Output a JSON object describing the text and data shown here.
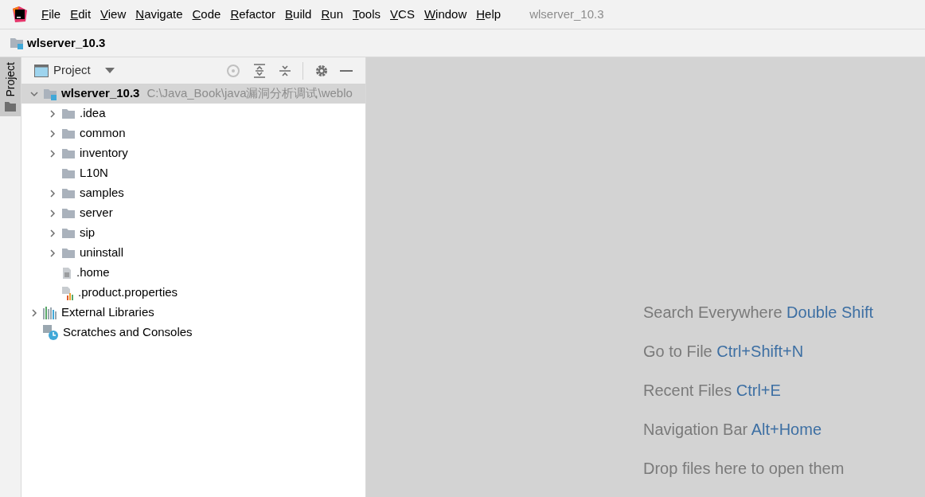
{
  "menu": [
    "File",
    "Edit",
    "View",
    "Navigate",
    "Code",
    "Refactor",
    "Build",
    "Run",
    "Tools",
    "VCS",
    "Window",
    "Help"
  ],
  "window_title": "wlserver_10.3",
  "breadcrumb": "wlserver_10.3",
  "side_tab": {
    "label": "Project",
    "selected": true
  },
  "panel": {
    "title": "Project"
  },
  "tree": [
    {
      "name": "wlserver_10.3",
      "path": "C:\\Java_Book\\java漏洞分析调试\\weblo",
      "kind": "module",
      "expanded": true,
      "selected": true,
      "children": [
        {
          "name": ".idea",
          "kind": "folder",
          "expanded": false,
          "selected": false
        },
        {
          "name": "common",
          "kind": "folder",
          "expanded": false,
          "selected": false
        },
        {
          "name": "inventory",
          "kind": "folder",
          "expanded": false,
          "selected": false
        },
        {
          "name": "L10N",
          "kind": "folder",
          "selected": false
        },
        {
          "name": "samples",
          "kind": "folder",
          "expanded": false,
          "selected": false
        },
        {
          "name": "server",
          "kind": "folder",
          "expanded": false,
          "selected": false
        },
        {
          "name": "sip",
          "kind": "folder",
          "expanded": false,
          "selected": false
        },
        {
          "name": "uninstall",
          "kind": "folder",
          "expanded": false,
          "selected": false
        },
        {
          "name": ".home",
          "kind": "file",
          "selected": false
        },
        {
          "name": ".product.properties",
          "kind": "properties",
          "selected": false
        }
      ]
    },
    {
      "name": "External Libraries",
      "kind": "libraries",
      "expanded": false,
      "selected": false
    },
    {
      "name": "Scratches and Consoles",
      "kind": "scratches",
      "selected": false
    }
  ],
  "hints": [
    {
      "action": "Search Everywhere",
      "shortcut": "Double Shift"
    },
    {
      "action": "Go to File",
      "shortcut": "Ctrl+Shift+N"
    },
    {
      "action": "Recent Files",
      "shortcut": "Ctrl+E"
    },
    {
      "action": "Navigation Bar",
      "shortcut": "Alt+Home"
    },
    {
      "action": "Drop files here to open them"
    }
  ]
}
